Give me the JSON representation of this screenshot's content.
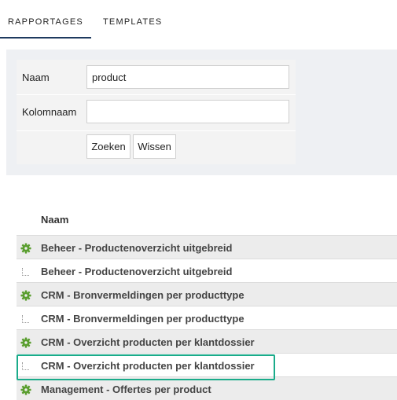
{
  "tabs": [
    {
      "label": "RAPPORTAGES",
      "active": true
    },
    {
      "label": "TEMPLATES",
      "active": false
    }
  ],
  "form": {
    "naam_label": "Naam",
    "naam_value": "product",
    "kolomnaam_label": "Kolomnaam",
    "kolomnaam_value": "",
    "zoeken_label": "Zoeken",
    "wissen_label": "Wissen"
  },
  "table": {
    "header": "Naam",
    "rows": [
      {
        "type": "parent",
        "icon": "gear-icon",
        "label": "Beheer - Productenoverzicht uitgebreid"
      },
      {
        "type": "child",
        "icon": "tree-branch-icon",
        "label": "Beheer - Productenoverzicht uitgebreid"
      },
      {
        "type": "parent",
        "icon": "gear-icon",
        "label": "CRM - Bronvermeldingen per producttype"
      },
      {
        "type": "child",
        "icon": "tree-branch-icon",
        "label": "CRM - Bronvermeldingen per producttype"
      },
      {
        "type": "parent",
        "icon": "gear-icon",
        "label": "CRM - Overzicht producten per klantdossier"
      },
      {
        "type": "child",
        "icon": "tree-branch-icon",
        "label": "CRM - Overzicht producten per klantdossier",
        "highlighted": true
      },
      {
        "type": "parent",
        "icon": "gear-icon",
        "label": "Management - Offertes per product"
      }
    ]
  },
  "colors": {
    "tab_underline": "#1e3a5f",
    "gear": "#5a9e2f",
    "highlight": "#1aab8a"
  }
}
